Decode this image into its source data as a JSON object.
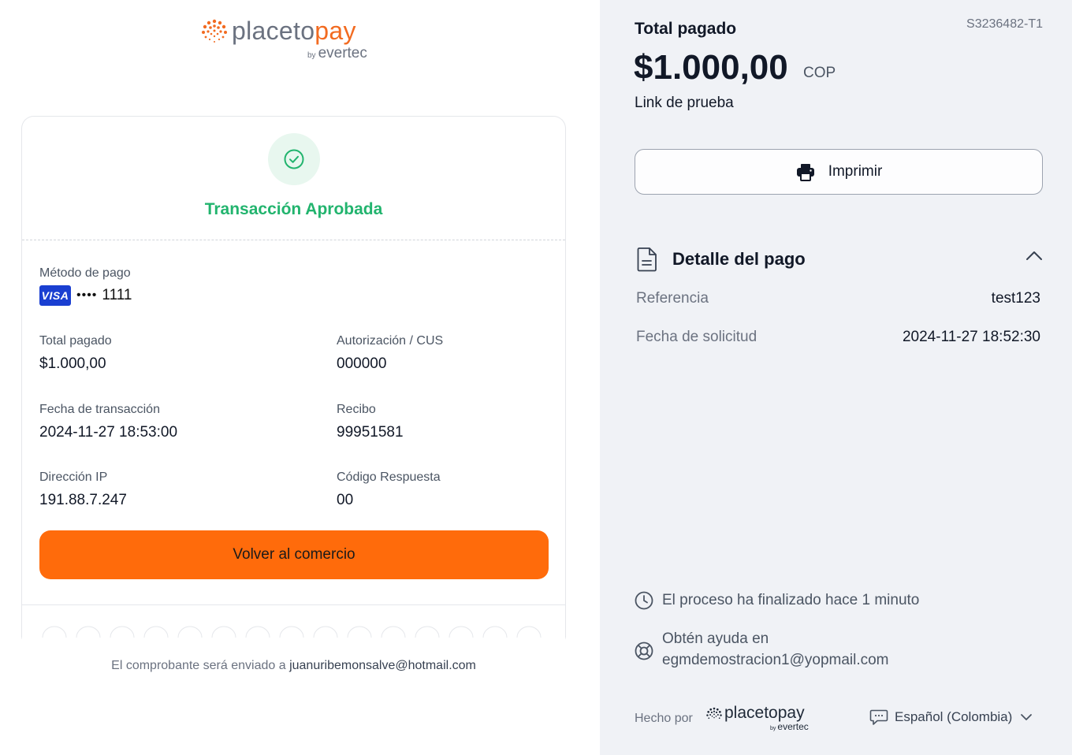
{
  "brand": {
    "logo_word_a": "placeto",
    "logo_word_b": "pay",
    "logo_by": "by",
    "logo_vendor": "evertec"
  },
  "status": {
    "title": "Transacción Aprobada",
    "color": "#22b46e"
  },
  "payment": {
    "method_label": "Método de pago",
    "card_brand": "VISA",
    "card_mask": "••••",
    "card_last4": "1111",
    "total_label": "Total pagado",
    "total_value": "$1.000,00",
    "auth_label": "Autorización / CUS",
    "auth_value": "000000",
    "date_label": "Fecha de transacción",
    "date_value": "2024-11-27 18:53:00",
    "receipt_label": "Recibo",
    "receipt_value": "99951581",
    "ip_label": "Dirección IP",
    "ip_value": "191.88.7.247",
    "code_label": "Código Respuesta",
    "code_value": "00"
  },
  "actions": {
    "back_label": "Volver al comercio",
    "print_label": "Imprimir"
  },
  "receipt_note": {
    "prefix": "El comprobante será enviado a",
    "email": "juanuribemonsalve@hotmail.com"
  },
  "summary": {
    "total_label": "Total pagado",
    "session_id": "S3236482-T1",
    "amount": "$1.000,00",
    "currency": "COP",
    "description": "Link de prueba"
  },
  "detail": {
    "title": "Detalle del pago",
    "rows": [
      {
        "key": "Referencia",
        "value": "test123"
      },
      {
        "key": "Fecha de solicitud",
        "value": "2024-11-27 18:52:30"
      }
    ]
  },
  "info": {
    "finished": "El proceso ha finalizado hace 1 minuto",
    "help_line1": "Obtén ayuda en",
    "help_line2": "egmdemostracion1@yopmail.com"
  },
  "footer": {
    "made_by": "Hecho por",
    "mini_logo_word": "placetopay",
    "mini_logo_by": "by",
    "mini_logo_vendor": "evertec",
    "language": "Español (Colombia)"
  },
  "colors": {
    "accent_orange": "#ff6b0b",
    "brand_orange": "#f26b21",
    "success_green": "#22b46e",
    "visa_blue": "#1a3fd1",
    "panel_bg": "#f0f2f6"
  }
}
